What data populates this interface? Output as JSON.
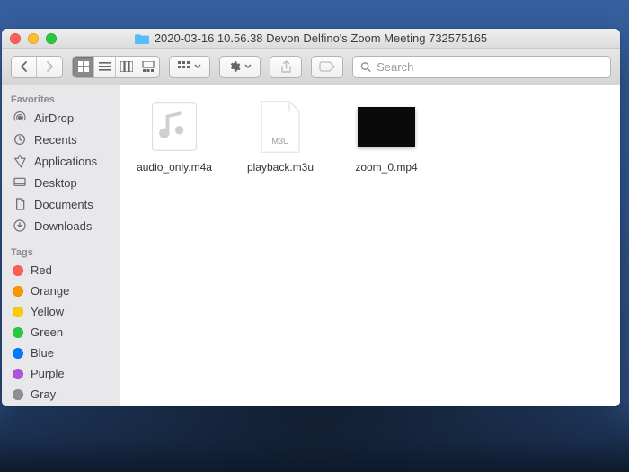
{
  "window": {
    "title": "2020-03-16 10.56.38 Devon Delfino's Zoom Meeting 732575165"
  },
  "search": {
    "placeholder": "Search"
  },
  "sidebar": {
    "favorites_label": "Favorites",
    "tags_label": "Tags",
    "favorites": [
      {
        "name": "AirDrop"
      },
      {
        "name": "Recents"
      },
      {
        "name": "Applications"
      },
      {
        "name": "Desktop"
      },
      {
        "name": "Documents"
      },
      {
        "name": "Downloads"
      }
    ],
    "tags": [
      {
        "name": "Red",
        "color": "#ff5f57"
      },
      {
        "name": "Orange",
        "color": "#ff9500"
      },
      {
        "name": "Yellow",
        "color": "#ffcc00"
      },
      {
        "name": "Green",
        "color": "#28c940"
      },
      {
        "name": "Blue",
        "color": "#007aff"
      },
      {
        "name": "Purple",
        "color": "#af52de"
      },
      {
        "name": "Gray",
        "color": "#8e8e93"
      }
    ]
  },
  "files": [
    {
      "name": "audio_only.m4a",
      "kind": "audio"
    },
    {
      "name": "playback.m3u",
      "kind": "m3u",
      "badge": "M3U"
    },
    {
      "name": "zoom_0.mp4",
      "kind": "video"
    }
  ]
}
